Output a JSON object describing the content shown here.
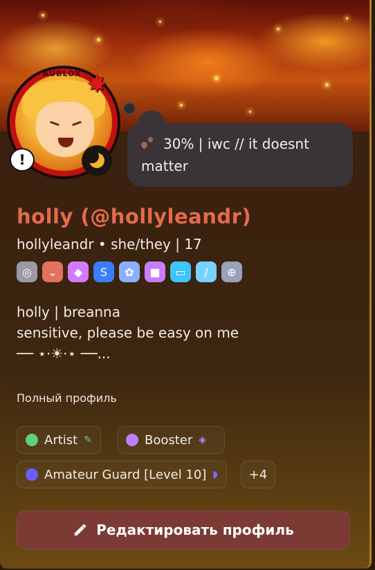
{
  "status": {
    "emoji_name": "brown-hearts",
    "text": "30% | iwc // it doesnt matter"
  },
  "profile": {
    "display_name": "holly (@hollyleandr)",
    "handle_line": "hollyleandr  •  she/they | 17",
    "ring_text": "AUBLOX"
  },
  "badges": [
    {
      "name": "nitro-badge",
      "glyph": "◎",
      "color": "#9a9aa6"
    },
    {
      "name": "hypesquad-badge",
      "glyph": "⌄",
      "color": "#e2725b"
    },
    {
      "name": "crystal-badge",
      "glyph": "◆",
      "color": "#d17bff"
    },
    {
      "name": "boost-badge",
      "glyph": "S",
      "color": "#3b7dff"
    },
    {
      "name": "laurel-badge",
      "glyph": "✿",
      "color": "#8ab0ff"
    },
    {
      "name": "gift-badge",
      "glyph": "■",
      "color": "#c77dff"
    },
    {
      "name": "monitor-badge",
      "glyph": "▭",
      "color": "#3ec4ff"
    },
    {
      "name": "sword-badge",
      "glyph": "/",
      "color": "#7ad1ff"
    },
    {
      "name": "controller-badge",
      "glyph": "⊕",
      "color": "#9aa2b8"
    }
  ],
  "bio": {
    "line1": "holly | breanna",
    "line2": "sensitive, please be easy on me",
    "line3": "── ⋆⋅☀⋅⋆ ──..."
  },
  "section": {
    "full_profile": "Полный профиль"
  },
  "roles": [
    {
      "label": "Artist",
      "dot_color": "#5fd17a",
      "icon": "🎨"
    },
    {
      "label": "Booster",
      "dot_color": "#c07dff",
      "icon": "◈"
    },
    {
      "label": "Amateur Guard [Level 10]",
      "dot_color": "#6a5cff",
      "icon": "◗"
    }
  ],
  "more_roles": "+4",
  "edit_button": {
    "label": "Редактировать профиль"
  }
}
